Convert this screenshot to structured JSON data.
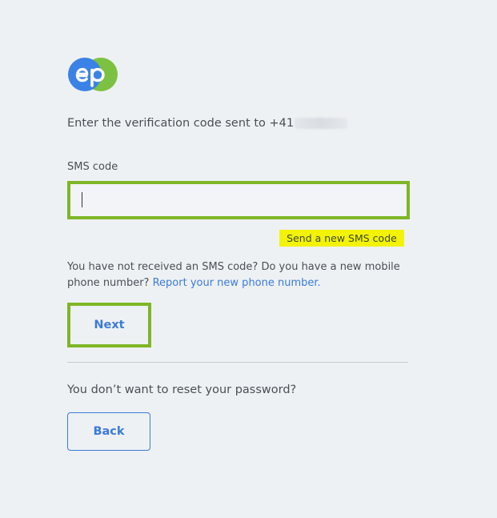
{
  "brand": {
    "logo_text": "ep",
    "blue": "#3b82e6",
    "green": "#7dc142"
  },
  "verification": {
    "instruction": "Enter the verification code sent to +41",
    "field_label": "SMS code",
    "field_value": "",
    "resend_label": "Send a new SMS code",
    "help_text": "You have not received an SMS code? Do you have a new mobile phone number? ",
    "help_link": "Report your new phone number.",
    "next_label": "Next"
  },
  "footer": {
    "question": "You don’t want to reset your password?",
    "back_label": "Back"
  },
  "colors": {
    "accent_blue": "#3b7bd8",
    "highlight_green": "#7fb626",
    "highlight_yellow": "#f3f30a",
    "background": "#eef1f4"
  }
}
